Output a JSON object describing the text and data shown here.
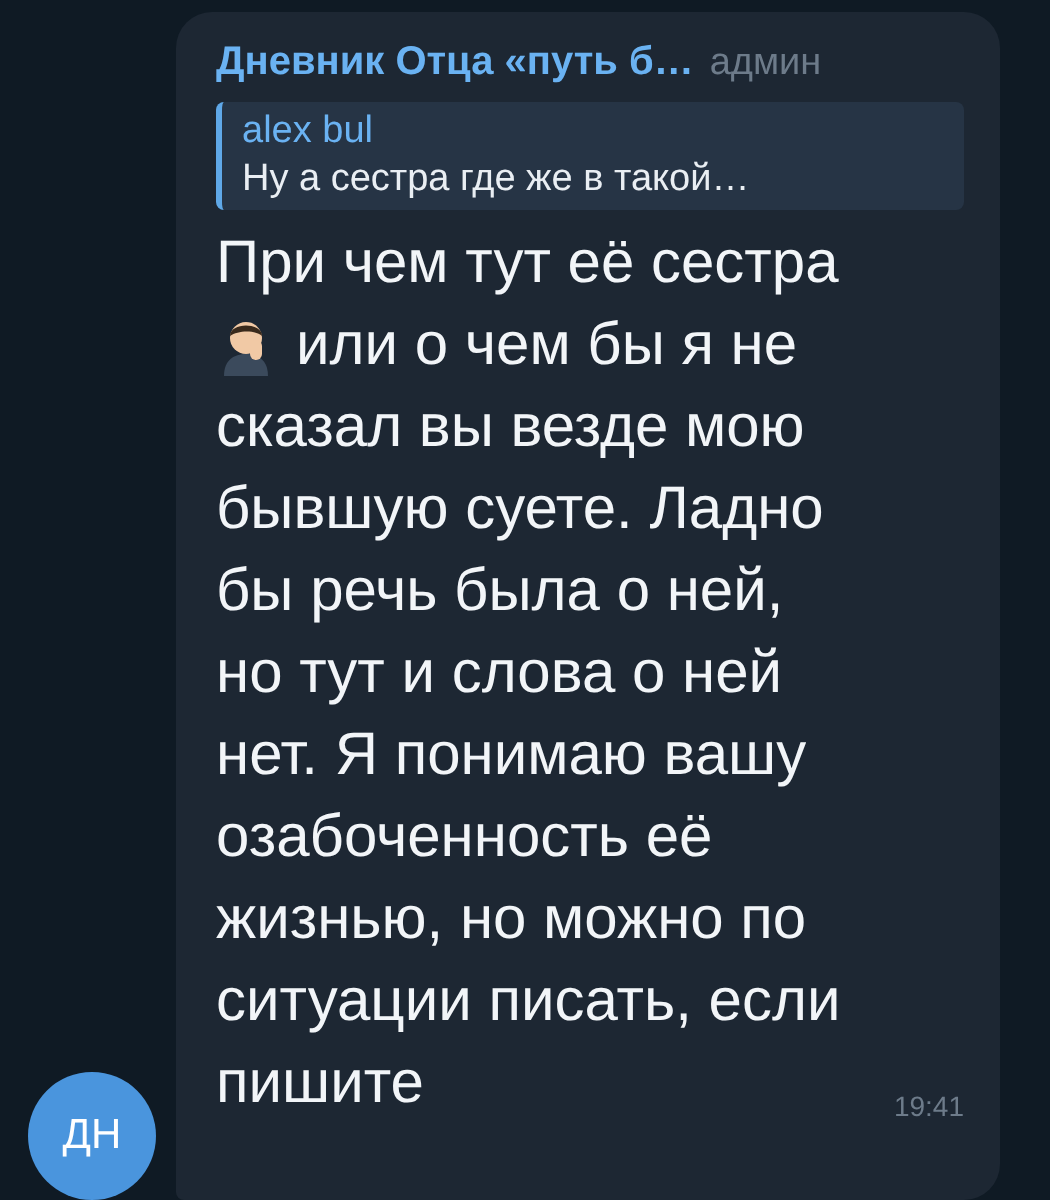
{
  "message": {
    "sender": "Дневник Отца «путь б…",
    "sender_role": "админ",
    "reply": {
      "author": "alex bul",
      "text": "Ну а сестра где же в такой…"
    },
    "lines": [
      {
        "text": "При чем тут её сестра",
        "with_emoji": false
      },
      {
        "text": "или о чем бы я не",
        "with_emoji": true
      },
      {
        "text": "сказал вы везде мою",
        "with_emoji": false
      },
      {
        "text": "бывшую суете. Ладно",
        "with_emoji": false
      },
      {
        "text": "бы речь была о ней,",
        "with_emoji": false
      },
      {
        "text": "но тут и слова о ней",
        "with_emoji": false
      },
      {
        "text": "нет. Я понимаю вашу",
        "with_emoji": false
      },
      {
        "text": "озабоченность её",
        "with_emoji": false
      },
      {
        "text": "жизнью, но можно по",
        "with_emoji": false
      },
      {
        "text": "ситуации писать, если",
        "with_emoji": false
      },
      {
        "text": "пишите",
        "with_emoji": false
      }
    ],
    "time": "19:41",
    "avatar": {
      "initials": "ДН"
    }
  }
}
